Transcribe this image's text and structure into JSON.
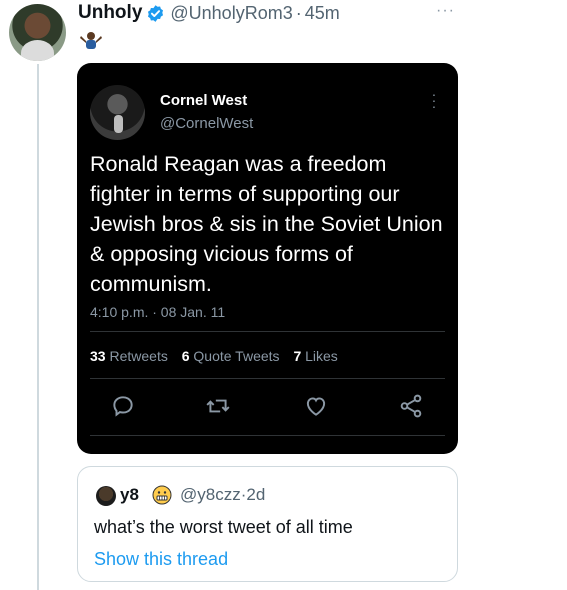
{
  "tweet": {
    "author_name": "Unholy",
    "author_handle": "@UnholyRom3",
    "separator": "·",
    "time": "45m",
    "more_label": "···",
    "emoji_name": "person-shrugging-emoji"
  },
  "embedded_tweet": {
    "author_name": "Cornel West",
    "author_handle": "@CornelWest",
    "text": "Ronald Reagan was a freedom fighter in terms of supporting our Jewish bros & sis in the Soviet Union & opposing vicious forms of communism.",
    "timestamp": "4:10 p.m. · 08 Jan. 11",
    "stats": {
      "retweets_count": "33",
      "retweets_label": "Retweets",
      "quotes_count": "6",
      "quotes_label": "Quote Tweets",
      "likes_count": "7",
      "likes_label": "Likes"
    },
    "actions": [
      "reply-icon",
      "retweet-icon",
      "like-icon",
      "share-icon"
    ]
  },
  "quoted_tweet": {
    "author_name": "y8",
    "author_handle": "@y8czz",
    "separator": "·",
    "time": "2d",
    "text": "what’s the worst tweet of all time",
    "link": "Show this thread"
  },
  "colors": {
    "verified": "#1d9bf0",
    "link": "#1d9bf0",
    "secondary_text": "#536471",
    "embed_background": "#000000"
  }
}
